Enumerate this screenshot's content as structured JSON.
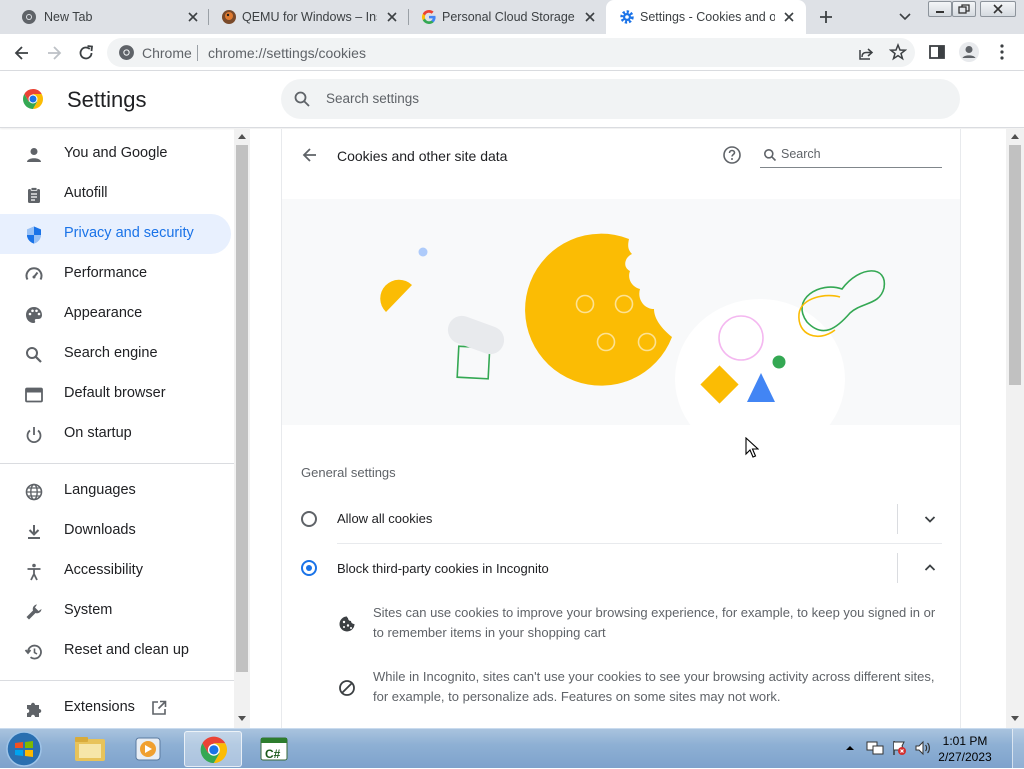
{
  "tabs": [
    {
      "title": "New Tab",
      "favicon": "chrome-icon"
    },
    {
      "title": "QEMU for Windows – Ins",
      "favicon": "qemu-icon"
    },
    {
      "title": "Personal Cloud Storage &",
      "favicon": "google-icon"
    },
    {
      "title": "Settings - Cookies and ot",
      "favicon": "settings-gear-icon",
      "active": true
    }
  ],
  "omnibox": {
    "site_label": "Chrome",
    "url": "chrome://settings/cookies"
  },
  "header": {
    "title": "Settings",
    "search_placeholder": "Search settings"
  },
  "sidebar": {
    "items": [
      {
        "label": "You and Google",
        "icon": "person-icon"
      },
      {
        "label": "Autofill",
        "icon": "clipboard-icon"
      },
      {
        "label": "Privacy and security",
        "icon": "shield-icon",
        "selected": true
      },
      {
        "label": "Performance",
        "icon": "speedometer-icon"
      },
      {
        "label": "Appearance",
        "icon": "palette-icon"
      },
      {
        "label": "Search engine",
        "icon": "search-icon"
      },
      {
        "label": "Default browser",
        "icon": "browser-window-icon"
      },
      {
        "label": "On startup",
        "icon": "power-icon"
      }
    ],
    "items2": [
      {
        "label": "Languages",
        "icon": "globe-icon"
      },
      {
        "label": "Downloads",
        "icon": "download-icon"
      },
      {
        "label": "Accessibility",
        "icon": "accessibility-icon"
      },
      {
        "label": "System",
        "icon": "wrench-icon"
      },
      {
        "label": "Reset and clean up",
        "icon": "history-icon"
      }
    ],
    "extensions": {
      "label": "Extensions",
      "icon": "puzzle-icon"
    }
  },
  "page": {
    "title": "Cookies and other site data",
    "search_placeholder": "Search",
    "section": "General settings",
    "options": [
      {
        "label": "Allow all cookies",
        "selected": false,
        "expanded": false
      },
      {
        "label": "Block third-party cookies in Incognito",
        "selected": true,
        "expanded": true
      }
    ],
    "details": [
      {
        "icon": "cookie-icon",
        "text": "Sites can use cookies to improve your browsing experience, for example, to keep you signed in or to remember items in your shopping cart"
      },
      {
        "icon": "block-icon",
        "text": "While in Incognito, sites can't use your cookies to see your browsing activity across different sites, for example, to personalize ads. Features on some sites may not work."
      }
    ]
  },
  "taskbar": {
    "time": "1:01 PM",
    "date": "2/27/2023"
  },
  "colors": {
    "accent": "#1a73e8",
    "cookie": "#fbbc04",
    "selected_bg": "#e8f0fe",
    "tabstrip": "#dee1e6"
  }
}
